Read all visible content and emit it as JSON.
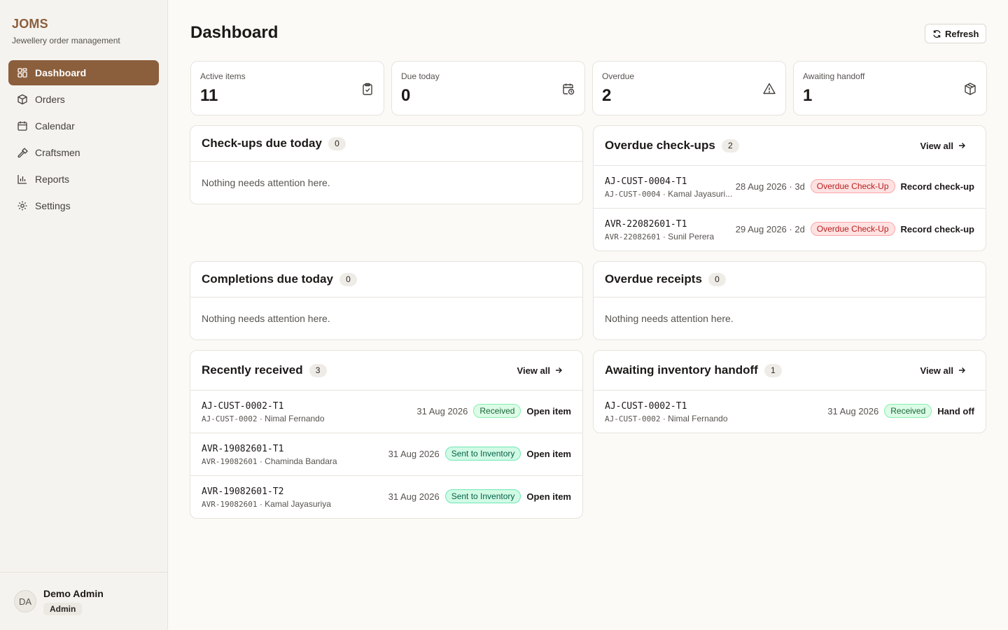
{
  "app": {
    "name": "JOMS",
    "tagline": "Jewellery order management"
  },
  "sidebar": {
    "items": [
      {
        "label": "Dashboard",
        "icon": "dashboard-icon"
      },
      {
        "label": "Orders",
        "icon": "box-icon"
      },
      {
        "label": "Calendar",
        "icon": "calendar-icon"
      },
      {
        "label": "Craftsmen",
        "icon": "hammer-icon"
      },
      {
        "label": "Reports",
        "icon": "bar-chart-icon"
      },
      {
        "label": "Settings",
        "icon": "gear-icon"
      }
    ],
    "user": {
      "initials": "DA",
      "name": "Demo Admin",
      "role": "Admin"
    }
  },
  "header": {
    "title": "Dashboard",
    "refresh_label": "Refresh"
  },
  "stats": [
    {
      "label": "Active items",
      "value": "11",
      "icon": "clipboard-check-icon"
    },
    {
      "label": "Due today",
      "value": "0",
      "icon": "calendar-clock-icon"
    },
    {
      "label": "Overdue",
      "value": "2",
      "icon": "warning-icon"
    },
    {
      "label": "Awaiting handoff",
      "value": "1",
      "icon": "package-icon"
    }
  ],
  "empty_text": "Nothing needs attention here.",
  "view_all_label": "View all",
  "cards": {
    "checkups_today": {
      "title": "Check-ups due today",
      "count": "0"
    },
    "overdue_checkups": {
      "title": "Overdue check-ups",
      "count": "2",
      "rows": [
        {
          "id": "AJ-CUST-0004-T1",
          "order": "AJ-CUST-0004",
          "customer": "Kamal Jayasuri...",
          "date": "28 Aug 2026 · 3d",
          "status": "Overdue Check-Up",
          "action": "Record check-up"
        },
        {
          "id": "AVR-22082601-T1",
          "order": "AVR-22082601",
          "customer": "Sunil Perera",
          "date": "29 Aug 2026 · 2d",
          "status": "Overdue Check-Up",
          "action": "Record check-up"
        }
      ]
    },
    "completions_today": {
      "title": "Completions due today",
      "count": "0"
    },
    "overdue_receipts": {
      "title": "Overdue receipts",
      "count": "0"
    },
    "recently_received": {
      "title": "Recently received",
      "count": "3",
      "rows": [
        {
          "id": "AJ-CUST-0002-T1",
          "order": "AJ-CUST-0002",
          "customer": "Nimal Fernando",
          "date": "31 Aug 2026",
          "status": "Received",
          "action": "Open item"
        },
        {
          "id": "AVR-19082601-T1",
          "order": "AVR-19082601",
          "customer": "Chaminda Bandara",
          "date": "31 Aug 2026",
          "status": "Sent to Inventory",
          "action": "Open item"
        },
        {
          "id": "AVR-19082601-T2",
          "order": "AVR-19082601",
          "customer": "Kamal Jayasuriya",
          "date": "31 Aug 2026",
          "status": "Sent to Inventory",
          "action": "Open item"
        }
      ]
    },
    "awaiting_handoff": {
      "title": "Awaiting inventory handoff",
      "count": "1",
      "rows": [
        {
          "id": "AJ-CUST-0002-T1",
          "order": "AJ-CUST-0002",
          "customer": "Nimal Fernando",
          "date": "31 Aug 2026",
          "status": "Received",
          "action": "Hand off"
        }
      ]
    }
  },
  "colors": {
    "accent": "#8b5e3c",
    "background": "#fbfaf7",
    "sidebar": "#f5f3ef"
  }
}
